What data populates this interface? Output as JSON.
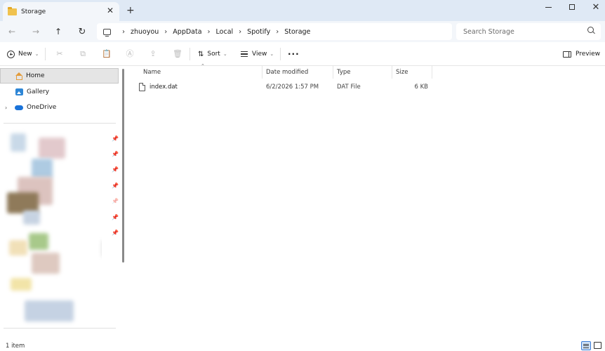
{
  "window": {
    "tab_title": "Storage",
    "tab_close_glyph": "✕",
    "new_tab_glyph": "+",
    "minimize_glyph": "",
    "close_glyph": "✕"
  },
  "nav": {
    "back_glyph": "←",
    "forward_glyph": "→",
    "up_glyph": "↑",
    "refresh_glyph": "↻"
  },
  "breadcrumb": {
    "items": [
      "zhuoyou",
      "AppData",
      "Local",
      "Spotify",
      "Storage"
    ],
    "separator": "›"
  },
  "search": {
    "placeholder": "Search Storage"
  },
  "toolbar": {
    "new_label": "New",
    "sort_label": "Sort",
    "view_label": "View",
    "more_glyph": "···",
    "preview_label": "Preview",
    "chevron_glyph": "⌄",
    "cut_glyph": "✂",
    "copy_glyph": "⧉",
    "paste_glyph": "📋",
    "rename_glyph": "Ⓐ",
    "share_glyph": "⇪",
    "delete_glyph": "🗑",
    "sort_glyph": "⇅"
  },
  "sidebar": {
    "items": [
      {
        "label": "Home"
      },
      {
        "label": "Gallery"
      },
      {
        "label": "OneDrive",
        "expand_glyph": "›"
      }
    ],
    "pin_glyph": "📌"
  },
  "file_list": {
    "sort_caret_glyph": "⌃",
    "columns": [
      "Name",
      "Date modified",
      "Type",
      "Size"
    ],
    "rows": [
      {
        "name": "index.dat",
        "date_modified": "6/2/2026 1:57 PM",
        "type": "DAT File",
        "size": "6 KB"
      }
    ]
  },
  "status": {
    "item_count": "1 item"
  },
  "colors": {
    "titlebar_bg": "#dfe9f5",
    "accent": "#3a7bd5",
    "folder": "#f0c24e",
    "onedrive": "#1a73d9",
    "home": "#e39b3a"
  }
}
